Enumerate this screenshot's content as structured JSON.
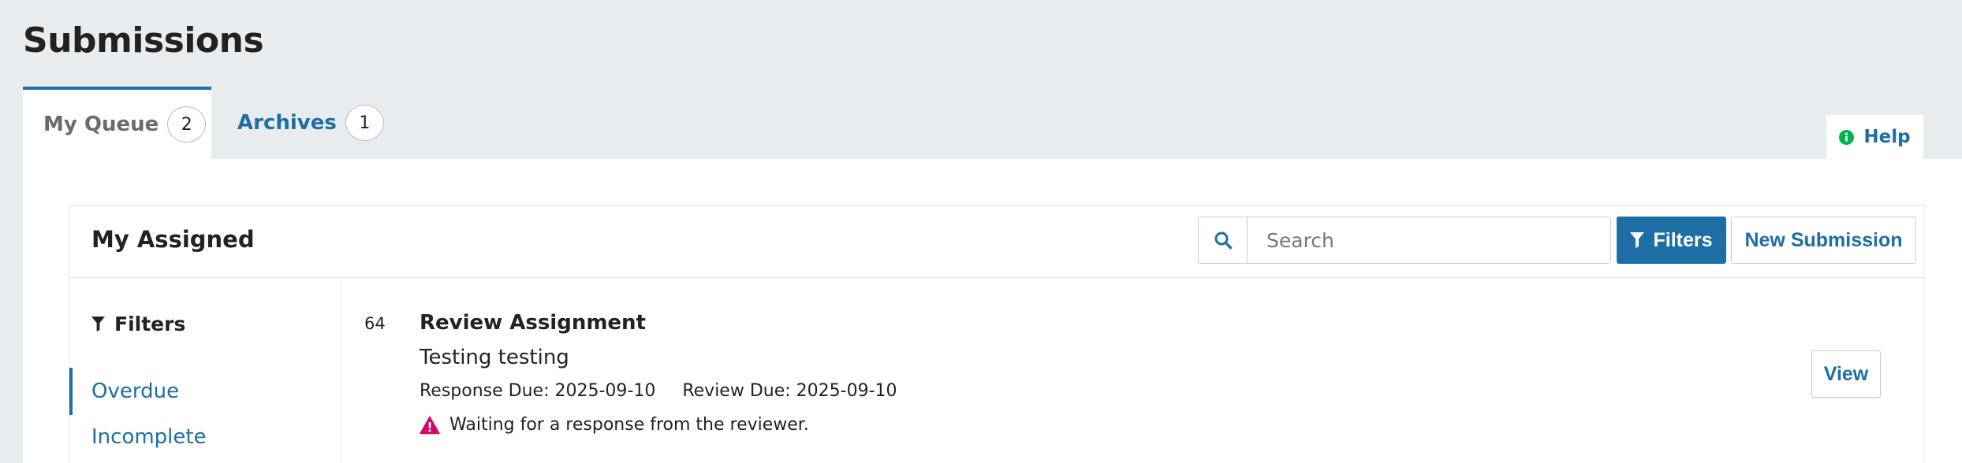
{
  "page": {
    "title": "Submissions"
  },
  "tabs": [
    {
      "label": "My Queue",
      "count": "2"
    },
    {
      "label": "Archives",
      "count": "1"
    }
  ],
  "help": {
    "label": "Help",
    "icon": "info-circle-icon",
    "icon_color": "#00b24e"
  },
  "panel": {
    "title": "My Assigned",
    "search": {
      "placeholder": "Search",
      "value": "",
      "icon": "search-icon"
    },
    "filters_button": {
      "label": "Filters",
      "icon": "filter-icon"
    },
    "new_submission_button": {
      "label": "New Submission"
    }
  },
  "sidebar": {
    "heading": "Filters",
    "items": [
      {
        "label": "Overdue",
        "selected": true
      },
      {
        "label": "Incomplete",
        "selected": false
      }
    ]
  },
  "submissions": [
    {
      "id": "64",
      "title": "Review Assignment",
      "subtitle": "Testing testing",
      "response_due": "Response Due: 2025-09-10",
      "review_due": "Review Due: 2025-09-10",
      "notice": "Waiting for a response from the reviewer.",
      "notice_icon": "warning-icon",
      "notice_color": "#d00a6c",
      "action": "View"
    }
  ],
  "colors": {
    "accent": "#1d6ea5",
    "background": "#e9ecee"
  }
}
